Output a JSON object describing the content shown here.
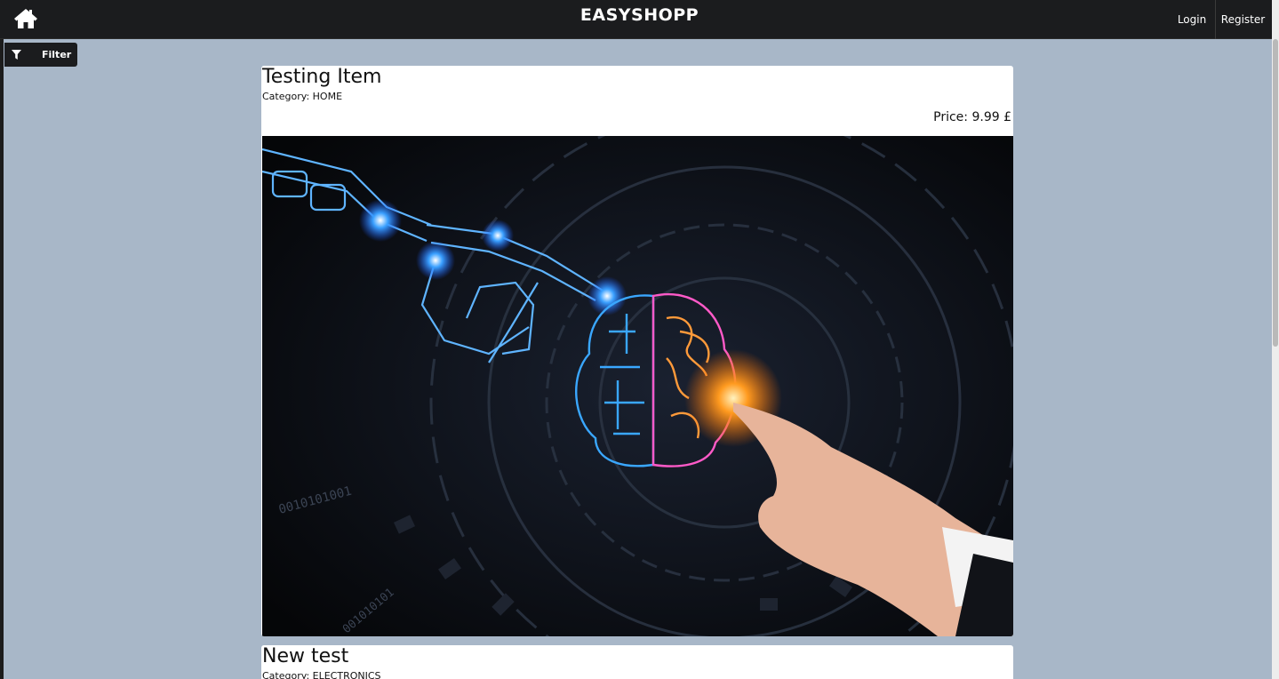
{
  "header": {
    "brand": "EASYSHOPP",
    "login_label": "Login",
    "register_label": "Register"
  },
  "filter": {
    "label": "Filter"
  },
  "products": [
    {
      "title": "Testing Item",
      "category": "Category: HOME",
      "price": "Price: 9.99 £"
    },
    {
      "title": "New test",
      "category": "Category: ELECTRONICS"
    }
  ],
  "colors": {
    "topbar": "#1b1c1e",
    "page_background": "#a8b7c8",
    "card_background": "#ffffff"
  },
  "icons": [
    "home-icon",
    "filter-icon"
  ]
}
